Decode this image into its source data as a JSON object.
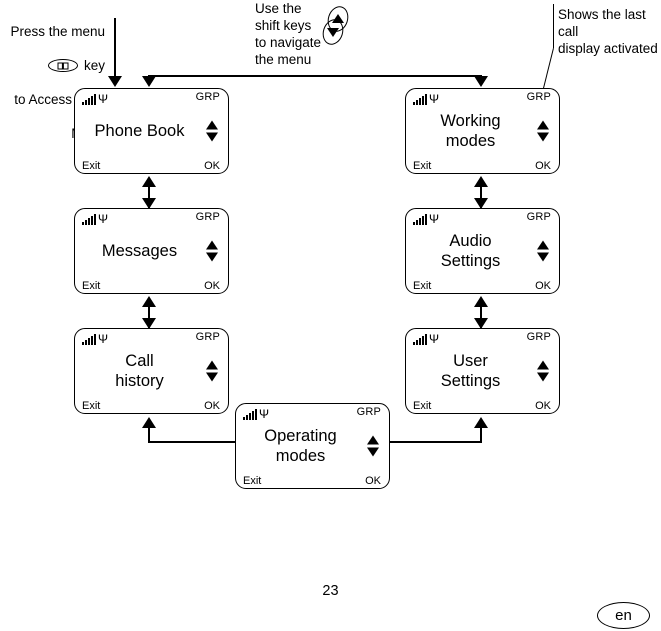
{
  "annotations": {
    "menu_key": {
      "line1": "Press the menu",
      "line2_suffix": "key",
      "line3": "to Access Main",
      "line4": "Menu",
      "icon": "menu-key-icon"
    },
    "shift_keys": {
      "text": "Use the\nshift keys\nto navigate\nthe menu",
      "icon": "shift-keys-icon"
    },
    "last_call": {
      "text": "Shows the last call\ndisplay activated"
    }
  },
  "screens": [
    {
      "id": "phone-book",
      "status_icon": "signal-strength-icon",
      "antenna_icon": "antenna-icon",
      "group": "GRP",
      "lines": [
        "Phone Book"
      ],
      "nav_up": "up-arrow-icon",
      "nav_down": "down-arrow-icon",
      "softkey_left": "Exit",
      "softkey_right": "OK"
    },
    {
      "id": "messages",
      "status_icon": "signal-strength-icon",
      "antenna_icon": "antenna-icon",
      "group": "GRP",
      "lines": [
        "Messages"
      ],
      "nav_up": "up-arrow-icon",
      "nav_down": "down-arrow-icon",
      "softkey_left": "Exit",
      "softkey_right": "OK"
    },
    {
      "id": "call-history",
      "status_icon": "signal-strength-icon",
      "antenna_icon": "antenna-icon",
      "group": "GRP",
      "lines": [
        "Call",
        "history"
      ],
      "nav_up": "up-arrow-icon",
      "nav_down": "down-arrow-icon",
      "softkey_left": "Exit",
      "softkey_right": "OK"
    },
    {
      "id": "working-modes",
      "status_icon": "signal-strength-icon",
      "antenna_icon": "antenna-icon",
      "group": "GRP",
      "lines": [
        "Working",
        "modes"
      ],
      "nav_up": "up-arrow-icon",
      "nav_down": "down-arrow-icon",
      "softkey_left": "Exit",
      "softkey_right": "OK"
    },
    {
      "id": "audio-settings",
      "status_icon": "signal-strength-icon",
      "antenna_icon": "antenna-icon",
      "group": "GRP",
      "lines": [
        "Audio",
        "Settings"
      ],
      "nav_up": "up-arrow-icon",
      "nav_down": "down-arrow-icon",
      "softkey_left": "Exit",
      "softkey_right": "OK"
    },
    {
      "id": "user-settings",
      "status_icon": "signal-strength-icon",
      "antenna_icon": "antenna-icon",
      "group": "GRP",
      "lines": [
        "User",
        "Settings"
      ],
      "nav_up": "up-arrow-icon",
      "nav_down": "down-arrow-icon",
      "softkey_left": "Exit",
      "softkey_right": "OK"
    },
    {
      "id": "operating-modes",
      "status_icon": "signal-strength-icon",
      "antenna_icon": "antenna-icon",
      "group": "GRP",
      "lines": [
        "Operating",
        "modes"
      ],
      "nav_up": "up-arrow-icon",
      "nav_down": "down-arrow-icon",
      "softkey_left": "Exit",
      "softkey_right": "OK"
    }
  ],
  "footer": {
    "page_number": "23",
    "language": "en"
  },
  "colors": {
    "ink": "#000000",
    "paper": "#ffffff"
  }
}
